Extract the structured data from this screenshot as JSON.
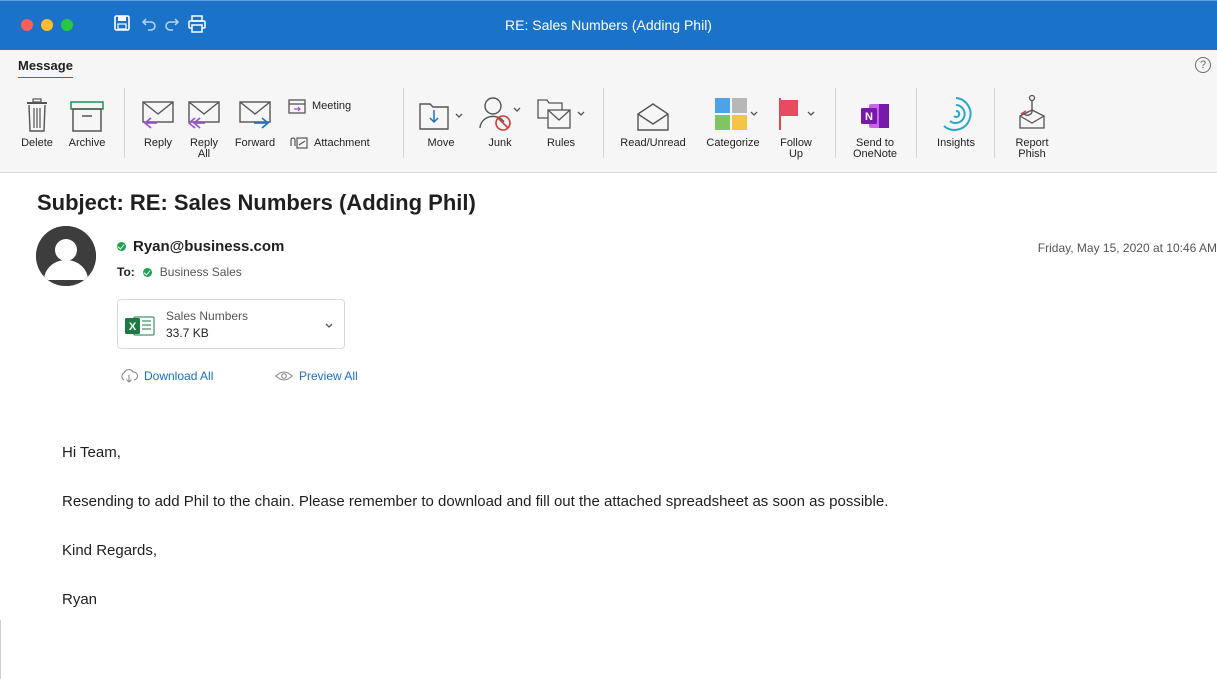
{
  "window": {
    "title": "RE: Sales Numbers (Adding Phil)"
  },
  "ribbon": {
    "tab": "Message",
    "help": "?",
    "buttons": {
      "delete": "Delete",
      "archive": "Archive",
      "reply": "Reply",
      "reply_all_1": "Reply",
      "reply_all_2": "All",
      "forward": "Forward",
      "meeting": "Meeting",
      "attachment": "Attachment",
      "move": "Move",
      "junk": "Junk",
      "rules": "Rules",
      "read_unread": "Read/Unread",
      "categorize": "Categorize",
      "follow_up_1": "Follow",
      "follow_up_2": "Up",
      "onenote_1": "Send to",
      "onenote_2": "OneNote",
      "insights": "Insights",
      "report_phish_1": "Report",
      "report_phish_2": "Phish"
    }
  },
  "message": {
    "subject": "Subject: RE: Sales Numbers (Adding Phil)",
    "sender": "Ryan@business.com",
    "to_label": "To:",
    "to_value": "Business Sales",
    "date": "Friday, May 15, 2020 at 10:46 AM",
    "attachment": {
      "name": "Sales Numbers",
      "size": "33.7 KB"
    },
    "download_all": "Download All",
    "preview_all": "Preview All",
    "body": {
      "greeting": "Hi Team,",
      "paragraph": "Resending to add Phil to the chain. Please remember to download and fill out the attached spreadsheet as soon as possible.",
      "closing": "Kind Regards,",
      "signature": "Ryan"
    }
  },
  "colors": {
    "titlebar": "#1a73c8",
    "link": "#1a6fc4",
    "presence_green": "#1aa34a",
    "excel_green": "#1e7a44"
  }
}
